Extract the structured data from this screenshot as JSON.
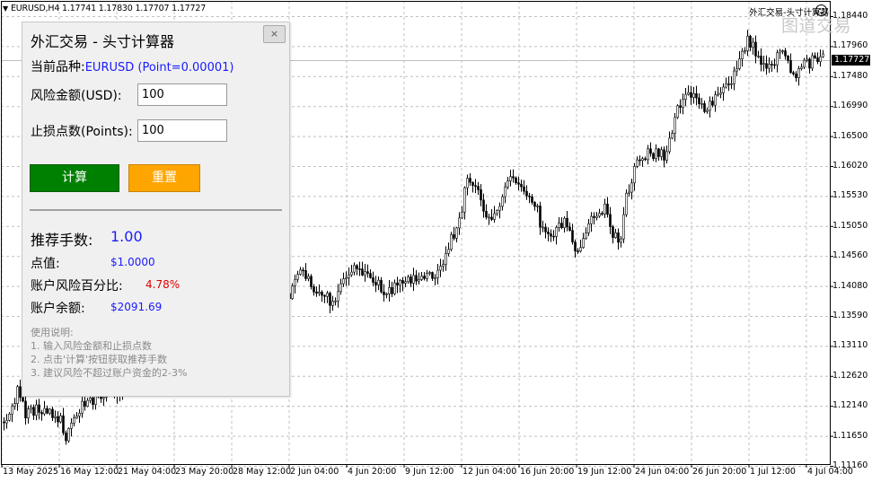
{
  "chart": {
    "symbol_line": "EURUSD,H4  1.17741 1.17830 1.17707 1.17727",
    "ea_name": "外汇交易-头寸计算器",
    "watermark": "图道交易",
    "current_price": "1.17727",
    "price_labels": [
      "1.18440",
      "1.17960",
      "1.17480",
      "1.16990",
      "1.16500",
      "1.16020",
      "1.15530",
      "1.15050",
      "1.14560",
      "1.14080",
      "1.13590",
      "1.13110",
      "1.12620",
      "1.12140",
      "1.11650",
      "1.11160"
    ],
    "time_labels": [
      "13 May 2025",
      "16 May 12:00",
      "21 May 04:00",
      "23 May 20:00",
      "28 May 12:00",
      "2 Jun 04:00",
      "4 Jun 20:00",
      "9 Jun 12:00",
      "12 Jun 04:00",
      "16 Jun 20:00",
      "19 Jun 12:00",
      "24 Jun 04:00",
      "26 Jun 20:00",
      "1 Jul 12:00",
      "4 Jul 04:00"
    ],
    "colors": {
      "candle": "#000000",
      "grid": "#c0c0c0",
      "current_price_line": "#c0c0c0"
    }
  },
  "panel": {
    "title": "外汇交易 - 头寸计算器",
    "close_label": "×",
    "symbol_label": "当前品种:",
    "symbol_value": "EURUSD (Point=0.00001)",
    "risk_label": "风险金额(USD):",
    "risk_value": "100",
    "stoploss_label": "止损点数(Points):",
    "stoploss_value": "100",
    "calc_label": "计算",
    "reset_label": "重置",
    "lots_label": "推荐手数:",
    "lots_value": "1.00",
    "point_value_label": "点值:",
    "point_value": "$1.0000",
    "risk_pct_label": "账户风险百分比:",
    "risk_pct_value": "4.78%",
    "balance_label": "账户余额:",
    "balance_value": "$2091.69",
    "usage_title": "使用说明:",
    "usage_lines": [
      "1. 输入风险金额和止损点数",
      "2. 点击'计算'按钮获取推荐手数",
      "3. 建议风险不超过账户资金的2-3%"
    ],
    "colors": {
      "blue": "#1a1aff",
      "red": "#e00000",
      "green_button": "#008000",
      "orange_button": "#ffa500"
    }
  }
}
